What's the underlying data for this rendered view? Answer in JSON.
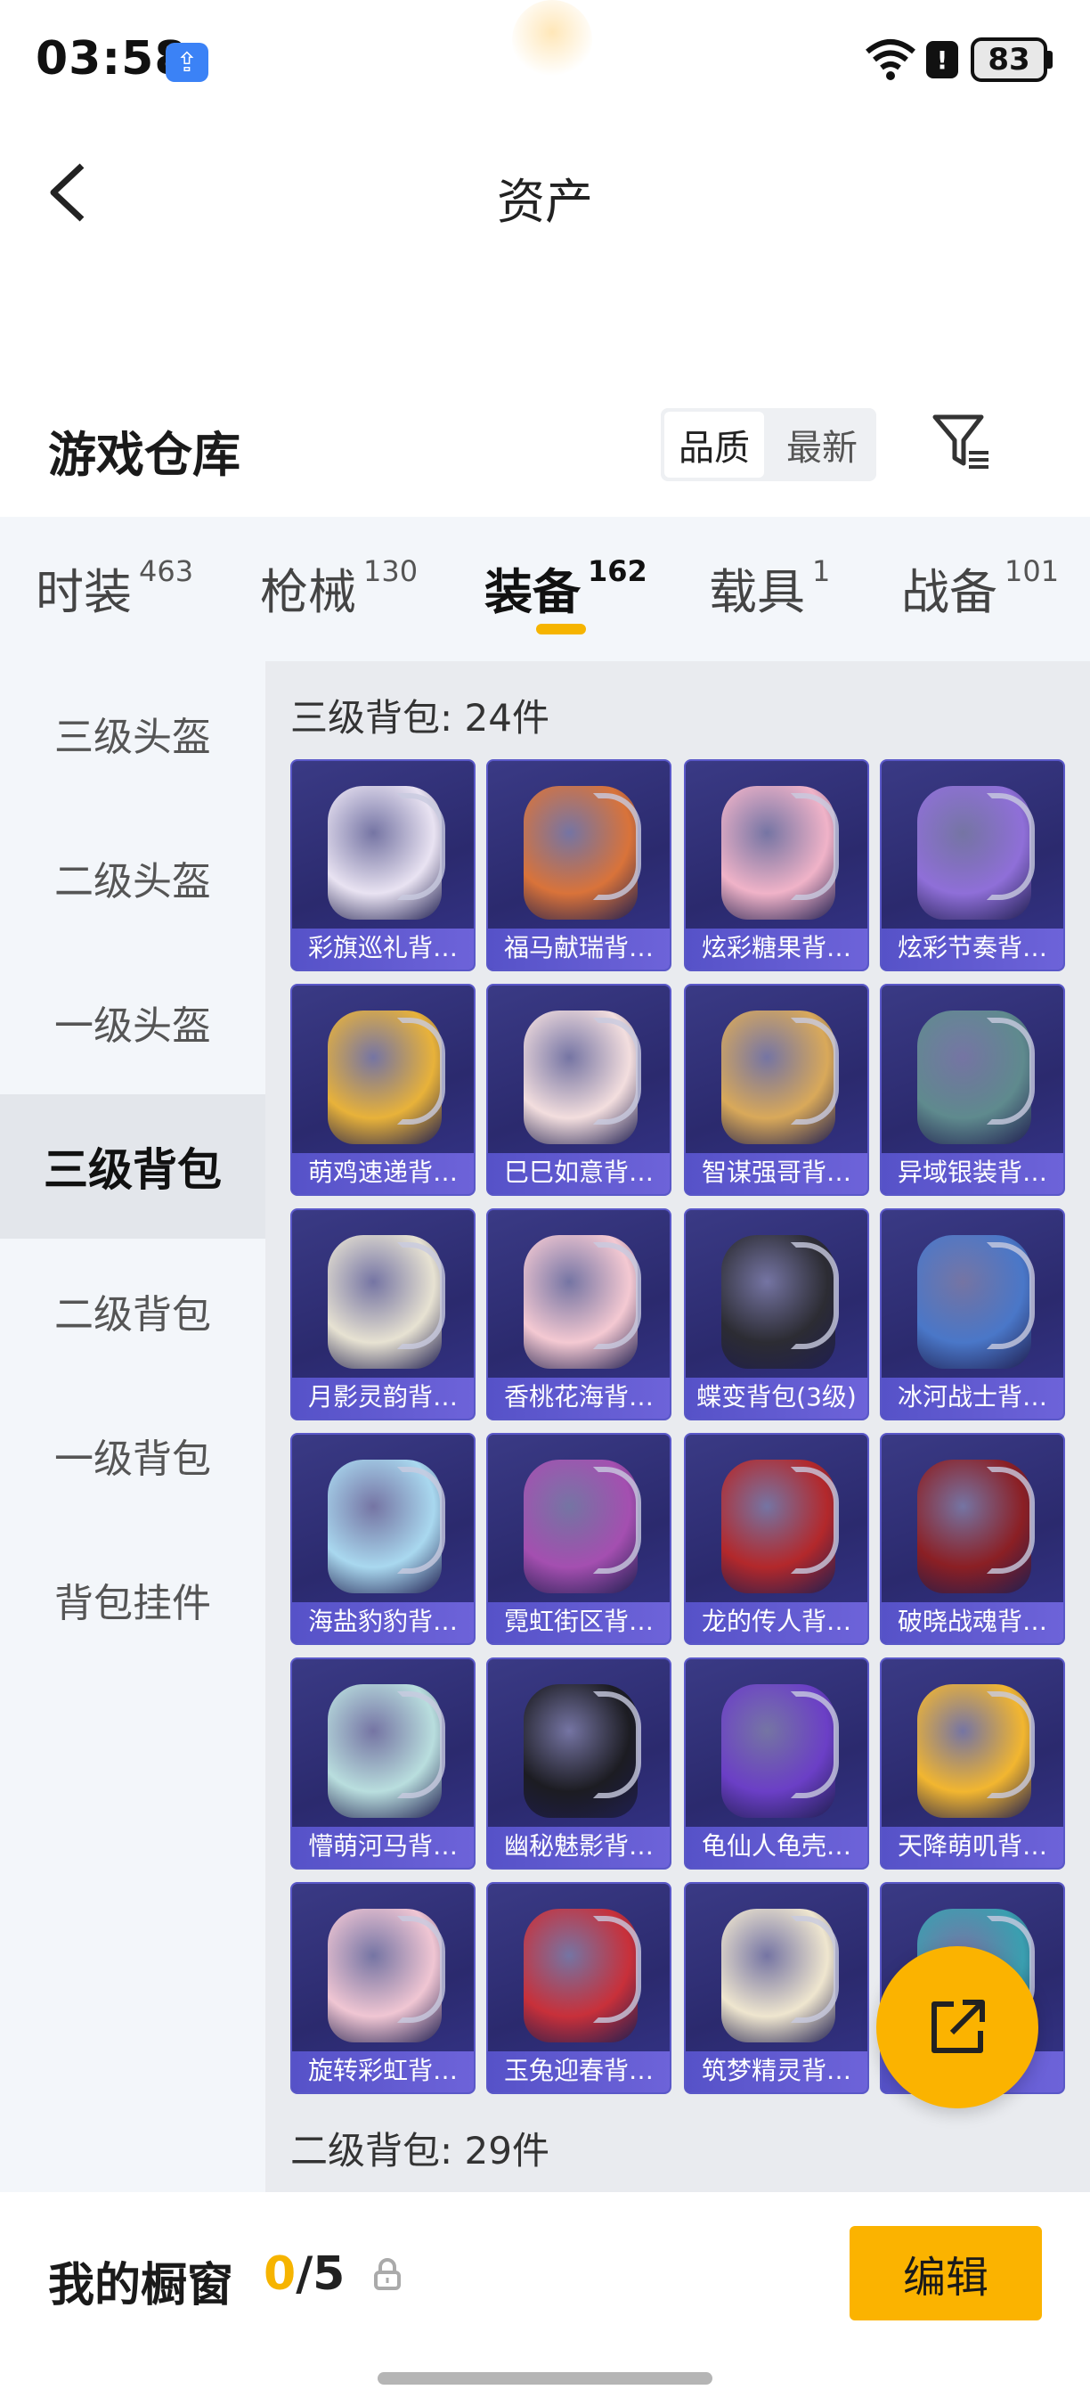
{
  "status_bar": {
    "time": "03:58",
    "battery": "83"
  },
  "header": {
    "title": "资产"
  },
  "warehouse": {
    "title": "游戏仓库",
    "sort_options": [
      "品质",
      "最新"
    ],
    "sort_selected": "品质"
  },
  "tabs": [
    {
      "label": "时装",
      "count": "463",
      "active": false
    },
    {
      "label": "枪械",
      "count": "130",
      "active": false
    },
    {
      "label": "装备",
      "count": "162",
      "active": true
    },
    {
      "label": "载具",
      "count": "1",
      "active": false
    },
    {
      "label": "战备",
      "count": "101",
      "active": false
    }
  ],
  "sidebar": {
    "items": [
      {
        "label": "三级头盔",
        "active": false
      },
      {
        "label": "二级头盔",
        "active": false
      },
      {
        "label": "一级头盔",
        "active": false
      },
      {
        "label": "三级背包",
        "active": true
      },
      {
        "label": "二级背包",
        "active": false
      },
      {
        "label": "一级背包",
        "active": false
      },
      {
        "label": "背包挂件",
        "active": false
      }
    ]
  },
  "sections": [
    {
      "title": "三级背包: 24件"
    },
    {
      "title": "二级背包: 29件"
    }
  ],
  "items": [
    {
      "name": "彩旗巡礼背…",
      "color": "#e9e3f2"
    },
    {
      "name": "福马献瑞背…",
      "color": "#d9733a"
    },
    {
      "name": "炫彩糖果背…",
      "color": "#f0b3c8"
    },
    {
      "name": "炫彩节奏背…",
      "color": "#8f6fd8"
    },
    {
      "name": "萌鸡速递背…",
      "color": "#e8b23a"
    },
    {
      "name": "巳巳如意背…",
      "color": "#f3dede"
    },
    {
      "name": "智谋强哥背…",
      "color": "#d9a95a"
    },
    {
      "name": "异域银装背…",
      "color": "#5f8a8e"
    },
    {
      "name": "月影灵韵背…",
      "color": "#e7e2d2"
    },
    {
      "name": "香桃花海背…",
      "color": "#f4c9d2"
    },
    {
      "name": "蝶变背包(3级)",
      "color": "#2c2c33"
    },
    {
      "name": "冰河战士背…",
      "color": "#4a77c8"
    },
    {
      "name": "海盐豹豹背…",
      "color": "#a9d8ef"
    },
    {
      "name": "霓虹街区背…",
      "color": "#a44fb0"
    },
    {
      "name": "龙的传人背…",
      "color": "#b3282b"
    },
    {
      "name": "破晓战魂背…",
      "color": "#8b1f24"
    },
    {
      "name": "懵萌河马背…",
      "color": "#b9dede"
    },
    {
      "name": "幽秘魅影背…",
      "color": "#1c1c22"
    },
    {
      "name": "龟仙人龟壳…",
      "color": "#6b3fc6"
    },
    {
      "name": "天降萌叽背…",
      "color": "#f2b630"
    },
    {
      "name": "旋转彩虹背…",
      "color": "#f0c6d3"
    },
    {
      "name": "玉兔迎春背…",
      "color": "#c8303a"
    },
    {
      "name": "筑梦精灵背…",
      "color": "#efe6cf"
    },
    {
      "name": "…",
      "color": "#3a9fb0"
    }
  ],
  "showcase": {
    "label": "我的橱窗",
    "current": "0",
    "total": "/5"
  },
  "edit_button": "编辑",
  "colors": {
    "accent": "#fbb300",
    "item_bg": "#2b2a6e",
    "item_label_bg": "#5652c8"
  }
}
